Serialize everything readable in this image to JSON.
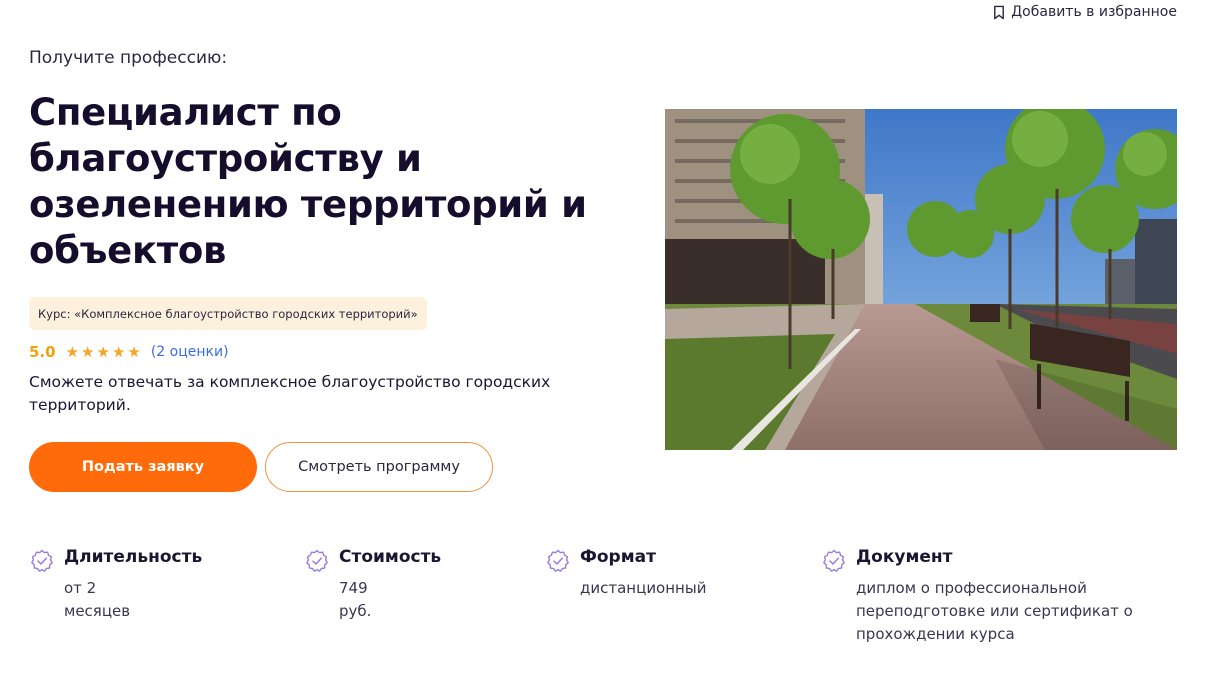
{
  "favorite": {
    "label": "Добавить в избранное",
    "icon": "bookmark-icon"
  },
  "hero": {
    "subtitle": "Получите профессию:",
    "title": "Специалист по благоустройству и озеленению территорий и объектов",
    "course_badge": "Курс: «Комплексное благоустройство городских территорий»",
    "rating": {
      "score": "5.0",
      "stars": 5,
      "count_label": "(2 оценки)"
    },
    "description": "Сможете отвечать за комплексное благоустройство городских территорий.",
    "primary_button": "Подать заявку",
    "secondary_button": "Смотреть программу"
  },
  "features": [
    {
      "title": "Длительность",
      "value": "от 2 месяцев",
      "icon": "verified-badge-icon"
    },
    {
      "title": "Стоимость",
      "value": "749 руб.",
      "icon": "verified-badge-icon"
    },
    {
      "title": "Формат",
      "value": "дистанционный",
      "icon": "verified-badge-icon"
    },
    {
      "title": "Документ",
      "value": "диплом о профессиональной переподготовке или сертификат о прохождении курса",
      "icon": "verified-badge-icon"
    }
  ],
  "colors": {
    "accent": "#ff6a0a",
    "title": "#140d2c",
    "badge_bg": "#fdf0dc",
    "star": "#f5a623",
    "link": "#3a6fd8",
    "icon": "#9b7be0"
  }
}
